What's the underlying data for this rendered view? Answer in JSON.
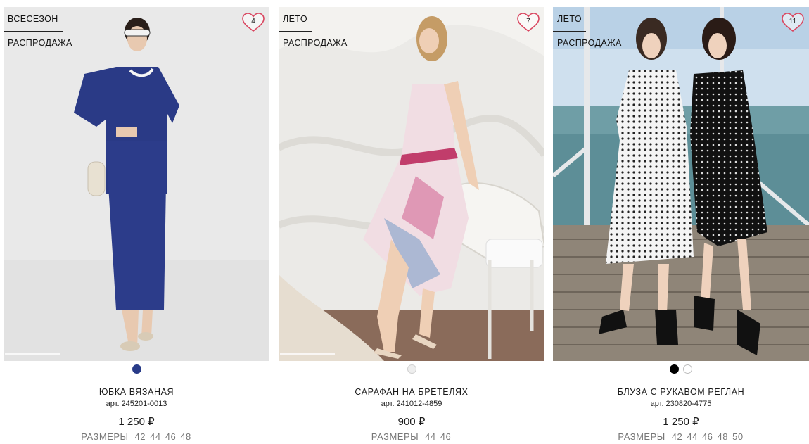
{
  "products": [
    {
      "season": "ВСЕСЕЗОН",
      "sale": "РАСПРОДАЖА",
      "favorites": "4",
      "colors": [
        "#283b88"
      ],
      "name": "ЮБКА ВЯЗАНАЯ",
      "art_label": "арт.",
      "art": "245201-0013",
      "price": "1 250 ₽",
      "sizes_label": "РАЗМЕРЫ",
      "sizes": [
        "42",
        "44",
        "46",
        "48"
      ]
    },
    {
      "season": "ЛЕТО",
      "sale": "РАСПРОДАЖА",
      "favorites": "7",
      "colors": [
        "#eeeeee"
      ],
      "name": "САРАФАН НА БРЕТЕЛЯХ",
      "art_label": "арт.",
      "art": "241012-4859",
      "price": "900 ₽",
      "sizes_label": "РАЗМЕРЫ",
      "sizes": [
        "44",
        "46"
      ]
    },
    {
      "season": "ЛЕТО",
      "sale": "РАСПРОДАЖА",
      "favorites": "11",
      "colors": [
        "#000000",
        "#ffffff"
      ],
      "name": "БЛУЗА С РУКАВОМ РЕГЛАН",
      "art_label": "арт.",
      "art": "230820-4775",
      "price": "1 250 ₽",
      "sizes_label": "РАЗМЕРЫ",
      "sizes": [
        "42",
        "44",
        "46",
        "48",
        "50"
      ]
    }
  ],
  "accent_color": "#d9455f"
}
